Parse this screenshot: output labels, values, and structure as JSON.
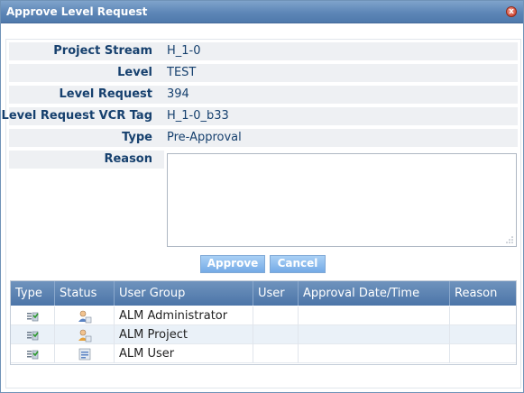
{
  "window": {
    "title": "Approve Level Request",
    "close_glyph": "x"
  },
  "fields": [
    {
      "label": "Project Stream",
      "value": "H_1-0"
    },
    {
      "label": "Level",
      "value": "TEST"
    },
    {
      "label": "Level Request",
      "value": "394"
    },
    {
      "label": "Level Request VCR Tag",
      "value": "H_1-0_b33"
    },
    {
      "label": "Type",
      "value": "Pre-Approval"
    },
    {
      "label": "Reason",
      "value": ""
    }
  ],
  "reason_textarea": {
    "value": "",
    "placeholder": ""
  },
  "buttons": {
    "approve": "Approve",
    "cancel": "Cancel"
  },
  "grid": {
    "columns": [
      "Type",
      "Status",
      "User Group",
      "User",
      "Approval Date/Time",
      "Reason"
    ],
    "rows": [
      {
        "type_icon": "approval-type-icon",
        "status_icon": "user-group-status-icon",
        "user_group": "ALM Administrator",
        "user": "",
        "date": "",
        "reason": ""
      },
      {
        "type_icon": "approval-type-icon",
        "status_icon": "user-group-status-icon",
        "user_group": "ALM Project",
        "user": "",
        "date": "",
        "reason": ""
      },
      {
        "type_icon": "approval-type-icon",
        "status_icon": "user-group-status-icon",
        "user_group": "ALM User",
        "user": "",
        "date": "",
        "reason": ""
      }
    ]
  },
  "colors": {
    "titlebar": "#5d86b7",
    "label": "#16406e",
    "button": "#74aae6",
    "grid_header": "#5a80b0"
  }
}
